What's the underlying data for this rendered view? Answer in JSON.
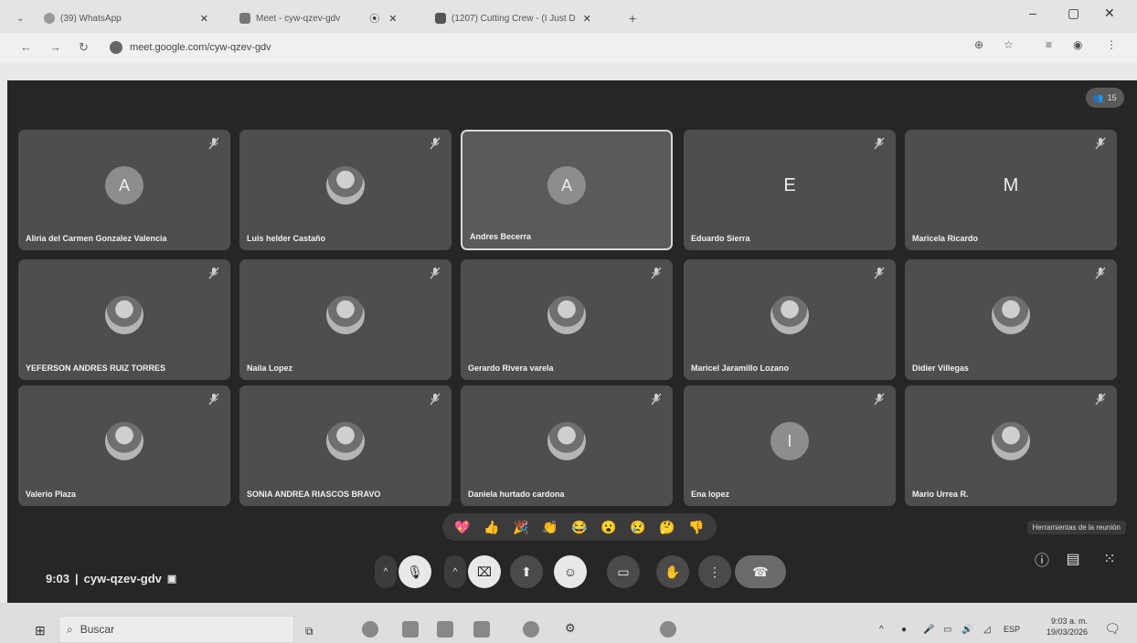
{
  "browser": {
    "tabs": [
      {
        "title": "(39) WhatsApp"
      },
      {
        "title": "Meet - cyw-qzev-gdv"
      },
      {
        "title": "(1207) Cutting Crew - (I Just D"
      }
    ],
    "new_tab": "+",
    "url": "meet.google.com/cyw-qzev-gdv"
  },
  "meet": {
    "participant_count": "15",
    "participants": [
      {
        "name": "Aliria del Carmen Gonzalez Valencia",
        "avatar": "A",
        "type": "letter"
      },
      {
        "name": "Luis helder Castaño",
        "avatar": "",
        "type": "photo"
      },
      {
        "name": "Andres Becerra",
        "avatar": "A",
        "type": "letter"
      },
      {
        "name": "Eduardo Sierra",
        "avatar": "E",
        "type": "bare"
      },
      {
        "name": "Maricela Ricardo",
        "avatar": "M",
        "type": "bare"
      },
      {
        "name": "YEFERSON ANDRES RUIZ TORRES",
        "avatar": "",
        "type": "photo"
      },
      {
        "name": "Naila Lopez",
        "avatar": "",
        "type": "photo"
      },
      {
        "name": "Gerardo Rivera varela",
        "avatar": "",
        "type": "photo"
      },
      {
        "name": "Maricel Jaramillo Lozano",
        "avatar": "",
        "type": "photo"
      },
      {
        "name": "Didier Villegas",
        "avatar": "",
        "type": "photo"
      },
      {
        "name": "Valerio Plaza",
        "avatar": "",
        "type": "photo"
      },
      {
        "name": "SONIA ANDREA RIASCOS BRAVO",
        "avatar": "",
        "type": "photo"
      },
      {
        "name": "Daniela hurtado cardona",
        "avatar": "",
        "type": "photo"
      },
      {
        "name": "Ena lopez",
        "avatar": "I",
        "type": "letter"
      },
      {
        "name": "Mario Urrea R.",
        "avatar": "",
        "type": "photo"
      }
    ],
    "reactions": [
      "💖",
      "👍",
      "🎉",
      "👏",
      "😂",
      "😮",
      "😢",
      "🤔",
      "👎"
    ],
    "time": "9:03",
    "separator": "|",
    "meeting_code": "cyw-qzev-gdv",
    "tooltip": "Herramientas de la reunión"
  },
  "taskbar": {
    "search_placeholder": "Buscar",
    "lang": "ESP",
    "time": "9:03 a. m.",
    "date": "19/03/2026"
  },
  "colors": {
    "active_tile_border": "#d8d8d8",
    "meet_bg": "#262626",
    "tile_bg": "#4e4e4e"
  }
}
